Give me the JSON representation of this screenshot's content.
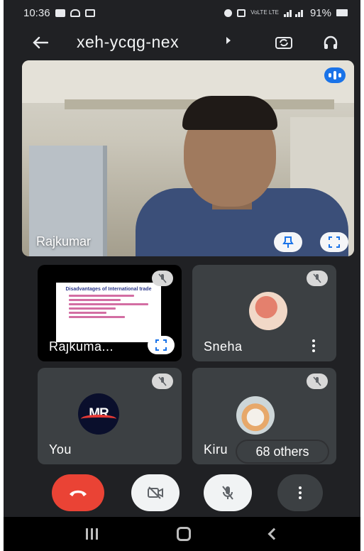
{
  "status_bar": {
    "time": "10:36",
    "network_label": "VoLTE LTE",
    "battery": "91%"
  },
  "appbar": {
    "meeting_code": "xeh-ycqg-nex"
  },
  "main_tile": {
    "participant_name": "Rajkumar"
  },
  "tiles": [
    {
      "name": "Rajkuma...",
      "content": "presentation",
      "slide_title": "Disadvantages of International trade"
    },
    {
      "name": "Sneha"
    },
    {
      "name": "You",
      "avatar_logo": "MR"
    },
    {
      "name": "Kiru",
      "others_label": "68 others"
    }
  ],
  "colors": {
    "background": "#202124",
    "tile": "#3c4043",
    "hangup": "#ea4335",
    "accent": "#1a73e8"
  },
  "icons": {
    "back": "arrow-left-icon",
    "switch_camera": "switch-camera-icon",
    "audio": "headphones-icon",
    "speaking": "audio-level-icon",
    "pin": "pin-icon",
    "fullscreen": "fullscreen-icon",
    "muted": "mic-off-icon",
    "hangup": "phone-hangup-icon",
    "camera_off": "video-off-icon",
    "more": "more-vert-icon"
  }
}
